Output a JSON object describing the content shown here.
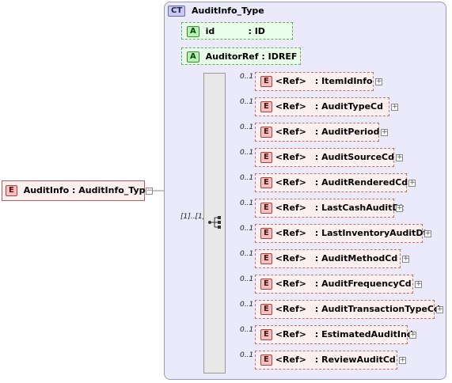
{
  "root_element": {
    "badge": "E",
    "name": "AuditInfo",
    "separator": ":",
    "type": "AuditInfo_Type"
  },
  "complex_type": {
    "badge": "CT",
    "name": "AuditInfo_Type"
  },
  "attributes": [
    {
      "badge": "A",
      "name": "id",
      "separator": ":",
      "type": "ID"
    },
    {
      "badge": "A",
      "name": "AuditorRef",
      "separator": ":",
      "type": "IDREF"
    }
  ],
  "sequence": {
    "occurrence": "[1]..[1]"
  },
  "elements": [
    {
      "badge": "E",
      "occurrence": "0..1",
      "ref": "<Ref>",
      "separator": ":",
      "name": "ItemIdInfo"
    },
    {
      "badge": "E",
      "occurrence": "0..1",
      "ref": "<Ref>",
      "separator": ":",
      "name": "AuditTypeCd"
    },
    {
      "badge": "E",
      "occurrence": "0..1",
      "ref": "<Ref>",
      "separator": ":",
      "name": "AuditPeriod"
    },
    {
      "badge": "E",
      "occurrence": "0..1",
      "ref": "<Ref>",
      "separator": ":",
      "name": "AuditSourceCd"
    },
    {
      "badge": "E",
      "occurrence": "0..1",
      "ref": "<Ref>",
      "separator": ":",
      "name": "AuditRenderedCd"
    },
    {
      "badge": "E",
      "occurrence": "0..1",
      "ref": "<Ref>",
      "separator": ":",
      "name": "LastCashAuditDt"
    },
    {
      "badge": "E",
      "occurrence": "0..1",
      "ref": "<Ref>",
      "separator": ":",
      "name": "LastInventoryAuditDt"
    },
    {
      "badge": "E",
      "occurrence": "0..1",
      "ref": "<Ref>",
      "separator": ":",
      "name": "AuditMethodCd"
    },
    {
      "badge": "E",
      "occurrence": "0..1",
      "ref": "<Ref>",
      "separator": ":",
      "name": "AuditFrequencyCd"
    },
    {
      "badge": "E",
      "occurrence": "0..1",
      "ref": "<Ref>",
      "separator": ":",
      "name": "AuditTransactionTypeCd"
    },
    {
      "badge": "E",
      "occurrence": "0..1",
      "ref": "<Ref>",
      "separator": ":",
      "name": "EstimatedAuditInd"
    },
    {
      "badge": "E",
      "occurrence": "0..1",
      "ref": "<Ref>",
      "separator": ":",
      "name": "ReviewAuditCd"
    }
  ],
  "expand_glyph": "+",
  "collapse_glyph": "−"
}
